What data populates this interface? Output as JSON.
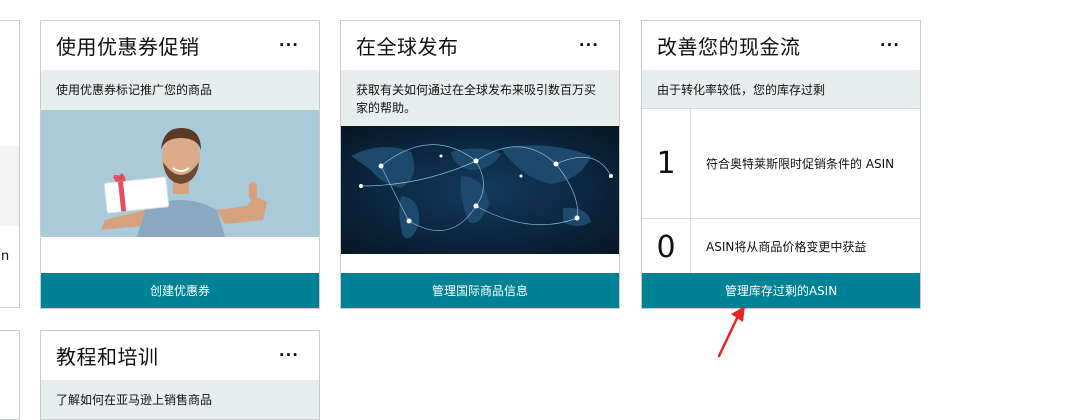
{
  "edge": {
    "char": "n"
  },
  "cards": {
    "coupon": {
      "title": "使用优惠券促销",
      "more": "···",
      "subtitle": "使用优惠券标记推广您的商品",
      "button": "创建优惠券"
    },
    "global": {
      "title": "在全球发布",
      "more": "···",
      "subtitle": "获取有关如何通过在全球发布来吸引数百万买家的帮助。",
      "button": "管理国际商品信息"
    },
    "cashflow": {
      "title": "改善您的现金流",
      "more": "···",
      "subtitle": "由于转化率较低，您的库存过剩",
      "metrics": [
        {
          "value": "1",
          "label": "符合奥特莱斯限时促销条件的 ASIN"
        },
        {
          "value": "0",
          "label": "ASIN将从商品价格变更中获益"
        }
      ],
      "button": "管理库存过剩的ASIN"
    },
    "tutorial": {
      "title": "教程和培训",
      "more": "···",
      "subtitle": "了解如何在亚马逊上销售商品"
    }
  },
  "colors": {
    "button_teal": "#008296",
    "subheader_bg": "#e8eded",
    "arrow_red": "#e8232a"
  }
}
